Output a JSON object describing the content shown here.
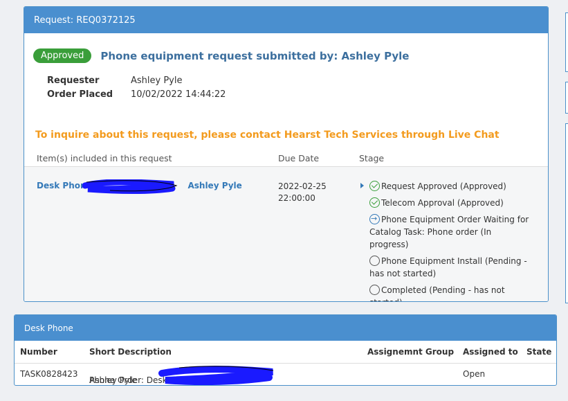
{
  "request_panel": {
    "header": "Request: REQ0372125",
    "status_badge": "Approved",
    "title": "Phone equipment request submitted by: Ashley Pyle",
    "info": [
      {
        "label": "Requester",
        "value": "Ashley Pyle"
      },
      {
        "label": "Order Placed",
        "value": "10/02/2022 14:44:22"
      }
    ],
    "inquire_text": "To inquire about this request, please contact Hearst Tech Services through Live Chat",
    "columns": [
      "Item(s) included in this request",
      "Due Date",
      "Stage"
    ],
    "item": {
      "name_prefix": "Desk Phone:",
      "name_suffix": "Ashley Pyle",
      "due_date": "2022-02-25",
      "due_time": "22:00:00",
      "stages": [
        {
          "text": "Request Approved (Approved)",
          "state": "done",
          "icon": "check-circle-icon"
        },
        {
          "text": "Telecom Approval (Approved)",
          "state": "done",
          "icon": "check-circle-icon"
        },
        {
          "text": "Phone Equipment Order Waiting for Catalog Task: Phone order (In progress)",
          "state": "in-progress",
          "icon": "arrow-circle-icon"
        },
        {
          "text": "Phone Equipment Install (Pending - has not started)",
          "state": "pending",
          "icon": "empty-circle-icon"
        },
        {
          "text": "Completed (Pending - has not started)",
          "state": "pending",
          "icon": "empty-circle-icon"
        }
      ]
    }
  },
  "desk_panel": {
    "header": "Desk Phone",
    "columns": [
      "Number",
      "Short Description",
      "Assignemnt Group",
      "Assigned to",
      "State"
    ],
    "row": {
      "number": "TASK0828423",
      "desc_prefix": "Phone Order: Desk P",
      "desc_suffix": "Ashley Pyle",
      "assignment_group": "",
      "assigned_to": "Open",
      "state": ""
    }
  },
  "colors": {
    "header_blue": "#4a8fcf",
    "badge_green": "#3a9e3a",
    "inquire_orange": "#f39b1e",
    "link_blue": "#3479b8",
    "redaction_blue": "#1a1aff"
  }
}
